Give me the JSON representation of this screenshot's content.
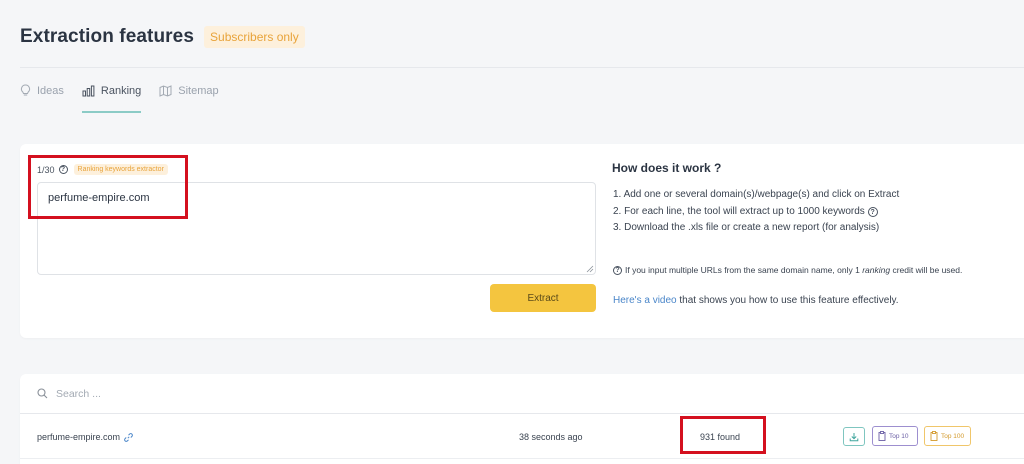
{
  "header": {
    "title": "Extraction features",
    "badge": "Subscribers only"
  },
  "tabs": [
    {
      "label": "Ideas",
      "icon": "lightbulb-icon",
      "active": false
    },
    {
      "label": "Ranking",
      "icon": "bar-chart-icon",
      "active": true
    },
    {
      "label": "Sitemap",
      "icon": "map-icon",
      "active": false
    }
  ],
  "extractor": {
    "counter": "1/30",
    "badge": "Ranking keywords extractor",
    "input_value": "perfume-empire.com",
    "button_label": "Extract"
  },
  "help": {
    "title": "How does it work ?",
    "steps": [
      "1. Add one or several domain(s)/webpage(s) and click on Extract",
      "2. For each line, the tool will extract up to 1000 keywords",
      "3. Download the .xls file or create a new report (for analysis)"
    ],
    "note_before": "If you input multiple URLs from the same domain name, only 1",
    "note_em": "ranking",
    "note_after": "credit will be used.",
    "video_link": "Here's a video",
    "video_rest": "that shows you how to use this feature effectively."
  },
  "results": {
    "search_placeholder": "Search ...",
    "rows": [
      {
        "domain": "perfume-empire.com",
        "time": "38 seconds ago",
        "found": "931 found",
        "top10_label": "Top 10",
        "top100_label": "Top 100"
      }
    ]
  },
  "colors": {
    "accent_teal": "#8bcbc6",
    "extract_button": "#f4c53f",
    "badge_orange": "#e8a33a",
    "highlight_red": "#d4101f",
    "link_blue": "#4a86c9"
  }
}
